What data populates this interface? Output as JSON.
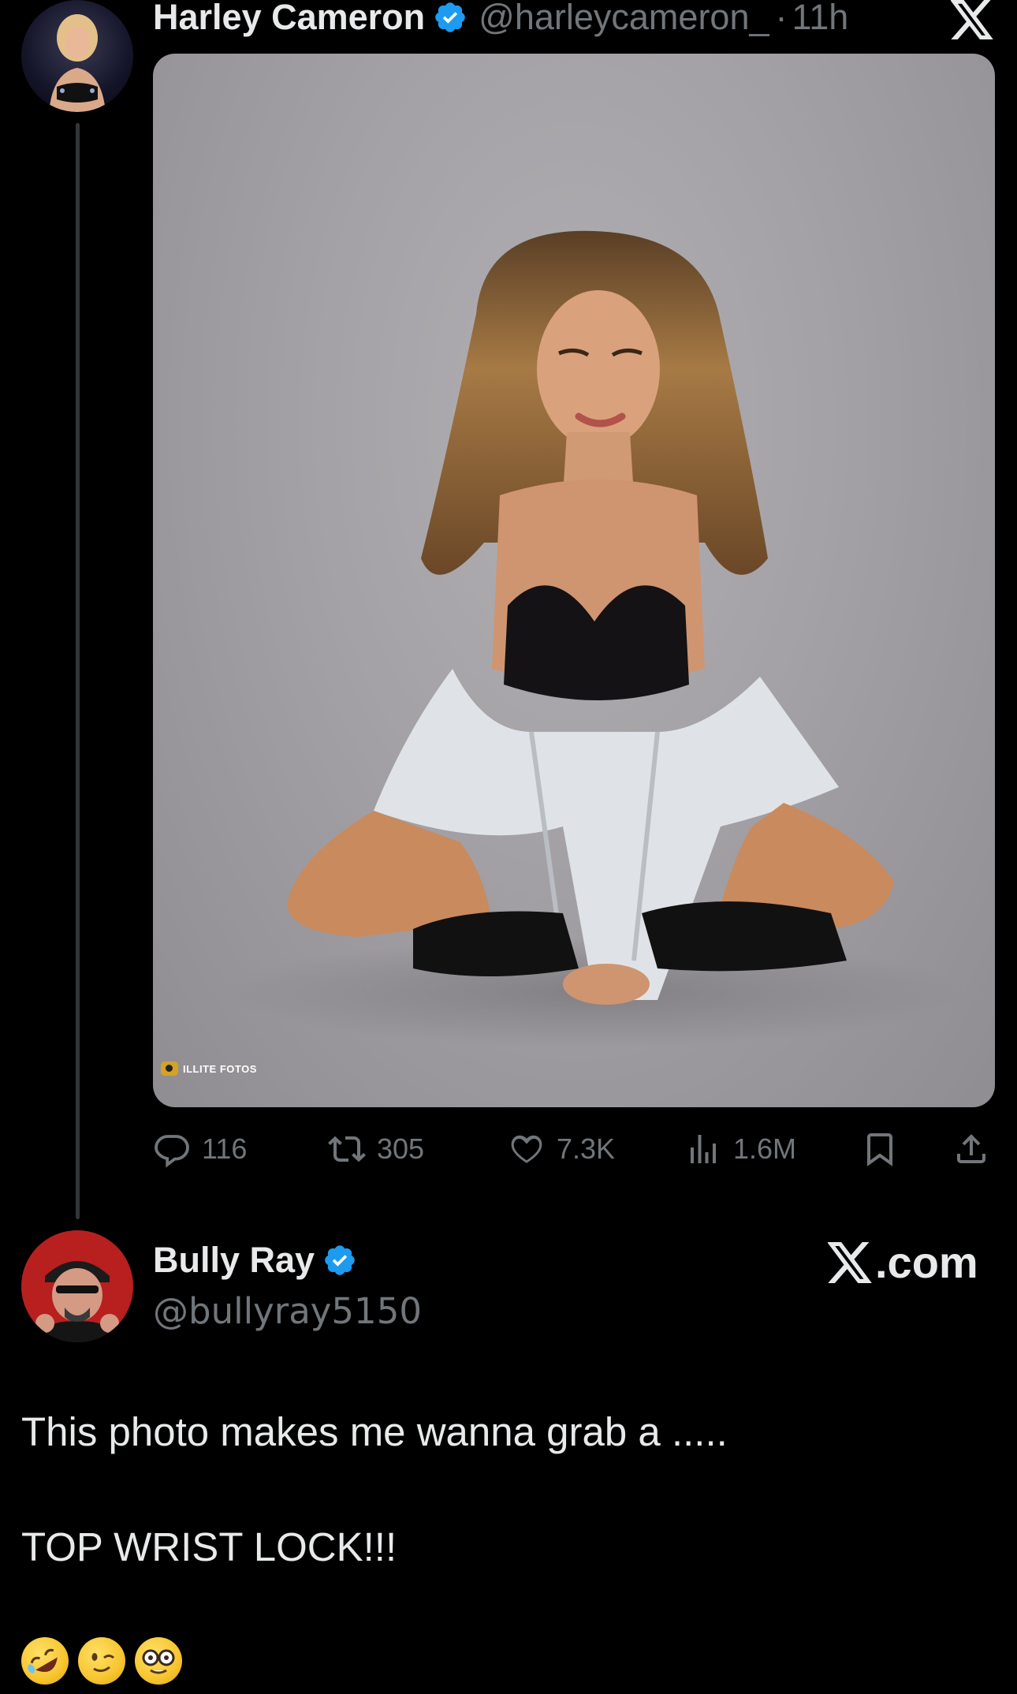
{
  "post1": {
    "display_name": "Harley Cameron",
    "handle": "@harleycameron_",
    "separator": "·",
    "time": "11h",
    "media_watermark": "ILLITE FOTOS",
    "actions": {
      "replies": "116",
      "reposts": "305",
      "likes": "7.3K",
      "views": "1.6M"
    }
  },
  "post2": {
    "display_name": "Bully Ray",
    "handle": "@bullyray5150",
    "source_label": ".com",
    "body_line1": "This photo makes me wanna grab a .....",
    "body_line2": "TOP WRIST LOCK!!!",
    "emojis": [
      "rolling-on-floor-laughing",
      "winking-face",
      "nerd-face"
    ]
  },
  "colors": {
    "background": "#000000",
    "text": "#e7e9ea",
    "secondary_text": "#71767b",
    "verified": "#1d9bf0",
    "thread_line": "#333639"
  }
}
